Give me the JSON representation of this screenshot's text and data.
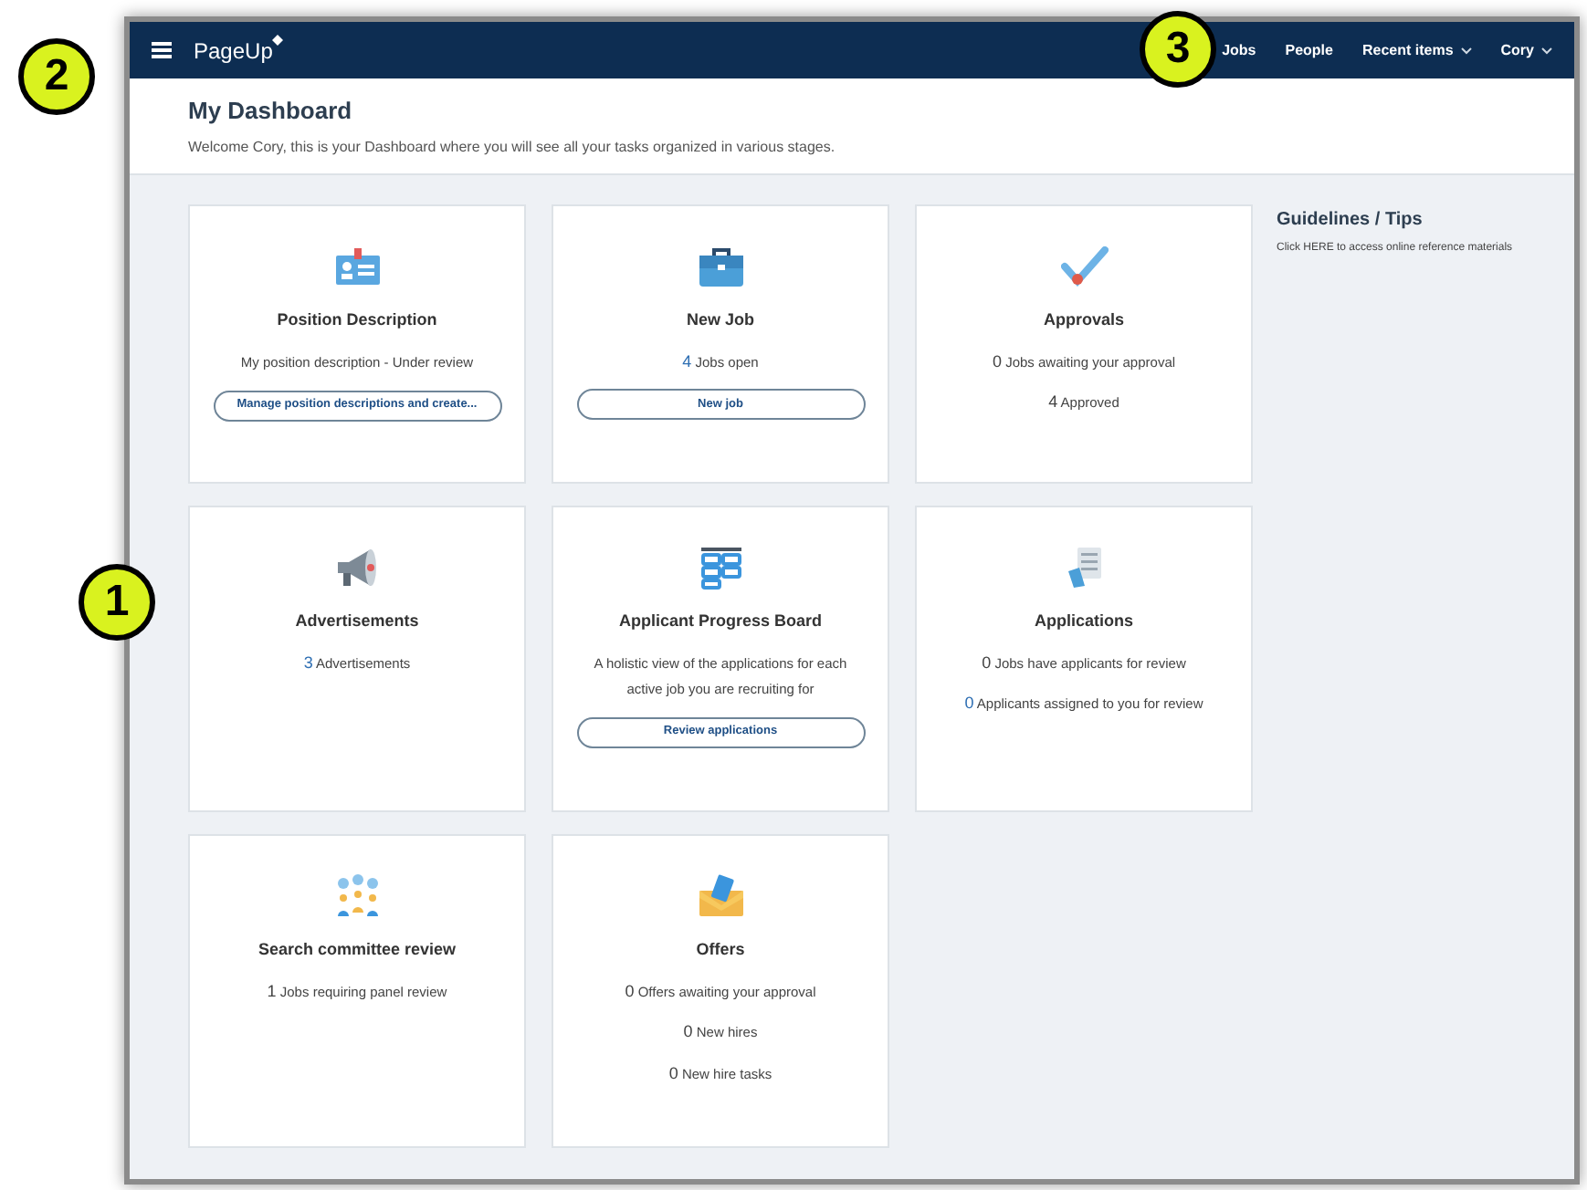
{
  "callouts": [
    {
      "label": "2"
    },
    {
      "label": "1"
    },
    {
      "label": "3"
    }
  ],
  "navbar": {
    "logo": "PageUp",
    "links": [
      {
        "label": "Jobs",
        "dropdown": false
      },
      {
        "label": "People",
        "dropdown": false
      },
      {
        "label": "Recent items",
        "dropdown": true
      },
      {
        "label": "Cory",
        "dropdown": true
      }
    ]
  },
  "header": {
    "title": "My Dashboard",
    "welcome": "Welcome Cory, this is your Dashboard where you will see all your tasks organized in various stages."
  },
  "cards": [
    {
      "title": "Position Description",
      "lines": [
        {
          "kind": "text",
          "text": "My position description - Under review"
        }
      ],
      "button": "Manage position descriptions and create..."
    },
    {
      "title": "New Job",
      "lines": [
        {
          "kind": "count",
          "count": "4",
          "text": "Jobs open",
          "highlight": true
        }
      ],
      "button": "New job"
    },
    {
      "title": "Approvals",
      "lines": [
        {
          "kind": "count",
          "count": "0",
          "text": "Jobs awaiting your approval",
          "highlight": false
        },
        {
          "kind": "count",
          "count": "4",
          "text": "Approved",
          "highlight": false
        }
      ]
    },
    {
      "title": "Advertisements",
      "lines": [
        {
          "kind": "count",
          "count": "3",
          "text": "Advertisements",
          "highlight": true
        }
      ]
    },
    {
      "title": "Applicant Progress Board",
      "lines": [
        {
          "kind": "text",
          "text": "A holistic view of the applications for each active job you are recruiting for"
        }
      ],
      "button": "Review applications"
    },
    {
      "title": "Applications",
      "lines": [
        {
          "kind": "count",
          "count": "0",
          "text": "Jobs have applicants for review",
          "highlight": false
        },
        {
          "kind": "count",
          "count": "0",
          "text": "Applicants assigned to you for review",
          "highlight": true
        }
      ]
    },
    {
      "title": "Search committee review",
      "lines": [
        {
          "kind": "count",
          "count": "1",
          "text": "Jobs requiring panel review",
          "highlight": false
        }
      ]
    },
    {
      "title": "Offers",
      "lines": [
        {
          "kind": "count",
          "count": "0",
          "text": "Offers awaiting your approval",
          "highlight": false
        },
        {
          "kind": "count",
          "count": "0",
          "text": "New hires",
          "highlight": false
        },
        {
          "kind": "count",
          "count": "0",
          "text": "New hire tasks",
          "highlight": false
        }
      ]
    }
  ],
  "tips": {
    "title": "Guidelines / Tips",
    "text": "Click HERE to access online reference materials"
  }
}
